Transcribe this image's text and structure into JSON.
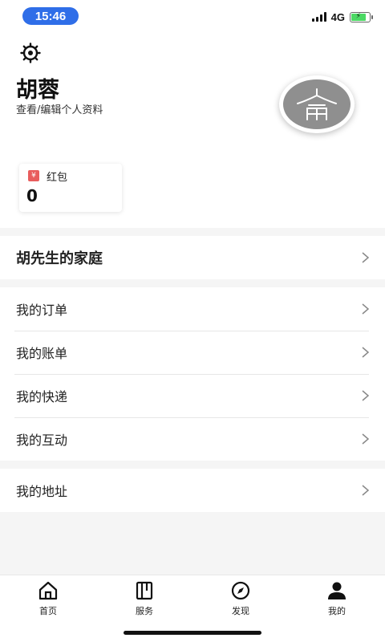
{
  "status_bar": {
    "time": "15:46",
    "network": "4G",
    "battery_level": 0.8,
    "battery_color": "#4cd964",
    "time_pill_color": "#2f6ee8"
  },
  "profile": {
    "settings_icon": "gear-icon",
    "name": "胡蓉",
    "edit_link": "查看/编辑个人资料",
    "avatar_icon": "avatar-glyph-icon"
  },
  "wallet": {
    "icon": "yen-icon",
    "icon_glyph": "¥",
    "label": "红包",
    "value": "0"
  },
  "family": {
    "label": "胡先生的家庭"
  },
  "menu": {
    "items": [
      {
        "label": "我的订单"
      },
      {
        "label": "我的账单"
      },
      {
        "label": "我的快递"
      },
      {
        "label": "我的互动"
      }
    ]
  },
  "address": {
    "label": "我的地址"
  },
  "tabbar": {
    "tabs": [
      {
        "label": "首页",
        "icon": "home-icon"
      },
      {
        "label": "服务",
        "icon": "book-icon"
      },
      {
        "label": "发现",
        "icon": "compass-icon"
      },
      {
        "label": "我的",
        "icon": "person-icon"
      }
    ]
  }
}
